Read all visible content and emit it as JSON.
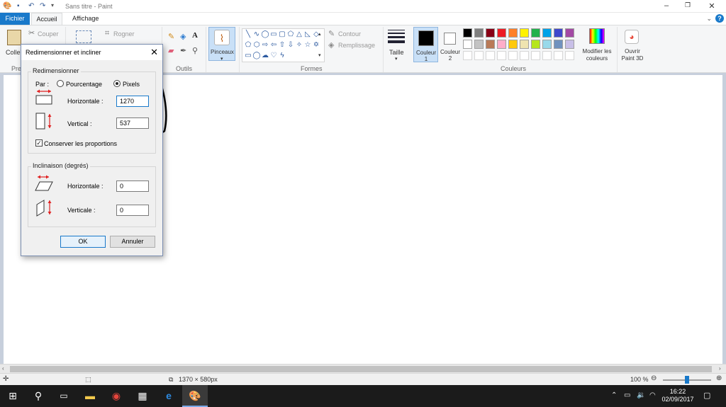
{
  "app": {
    "title": "Sans titre - Paint"
  },
  "tabs": [
    {
      "label": "Fichier"
    },
    {
      "label": "Accueil"
    },
    {
      "label": "Affichage"
    }
  ],
  "ribbon": {
    "presse_papiers": {
      "coller": "Coller",
      "couper": "Couper",
      "group_label": "Pre"
    },
    "image": {
      "rogner": "Rogner"
    },
    "outils": {
      "group_label": "Outils"
    },
    "pinceaux": {
      "label": "Pinceaux"
    },
    "formes": {
      "contour": "Contour",
      "remplissage": "Remplissage",
      "group_label": "Formes"
    },
    "taille": {
      "label": "Taille"
    },
    "couleurs": {
      "couleur1": "Couleur 1",
      "couleur2": "Couleur 2",
      "modifier": "Modifier les couleurs",
      "group_label": "Couleurs",
      "couleur1_value": "#000000",
      "couleur2_value": "#ffffff",
      "palette_row1": [
        "#000000",
        "#7f7f7f",
        "#880015",
        "#ed1c24",
        "#ff7f27",
        "#fff200",
        "#22b14c",
        "#00a2e8",
        "#3f48cc",
        "#a349a4"
      ],
      "palette_row2": [
        "#ffffff",
        "#c3c3c3",
        "#b97a57",
        "#ffaec9",
        "#ffc90e",
        "#efe4b0",
        "#b5e61d",
        "#99d9ea",
        "#7092be",
        "#c8bfe7"
      ]
    },
    "paint3d": {
      "label": "Ouvrir Paint 3D"
    }
  },
  "dialog": {
    "title": "Redimensionner et incliner",
    "resize": {
      "legend": "Redimensionner",
      "by_label": "Par :",
      "option_percent": "Pourcentage",
      "option_pixels": "Pixels",
      "selected": "pixels",
      "horizontal_label": "Horizontale :",
      "horizontal_value": "1270",
      "vertical_label": "Vertical :",
      "vertical_value": "537",
      "keep_ratio_label": "Conserver les proportions",
      "keep_ratio_checked": true
    },
    "skew": {
      "legend": "Inclinaison (degrés)",
      "horizontal_label": "Horizontale :",
      "horizontal_value": "0",
      "vertical_label": "Verticale :",
      "vertical_value": "0"
    },
    "ok_label": "OK",
    "cancel_label": "Annuler"
  },
  "status": {
    "canvas_size": "1370 × 580px",
    "zoom": "100 %",
    "zoom_level": 1.0
  },
  "taskbar": {
    "time": "16:22",
    "date": "02/09/2017"
  }
}
